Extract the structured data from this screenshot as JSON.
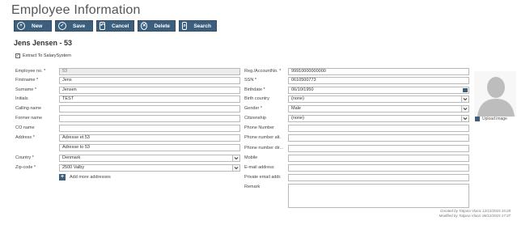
{
  "page": {
    "title": "Employee Information"
  },
  "toolbar": {
    "buttons": [
      {
        "label": "New",
        "icon": "plus-circle-icon"
      },
      {
        "label": "Save",
        "icon": "check-circle-icon"
      },
      {
        "label": "Cancel",
        "icon": "cancel-icon"
      },
      {
        "label": "Delete",
        "icon": "delete-x-icon"
      },
      {
        "label": "Search",
        "icon": "search-icon"
      }
    ]
  },
  "employee": {
    "heading": "Jens Jensen - 53"
  },
  "extract": {
    "label": "Extract To SalarySystem",
    "checked": true
  },
  "left": {
    "employee_no": {
      "label": "Employee no. *",
      "value": "53"
    },
    "firstname": {
      "label": "Firstname *",
      "value": "Jens"
    },
    "surname": {
      "label": "Surname *",
      "value": "Jensen"
    },
    "initials": {
      "label": "Initials",
      "value": "TEST"
    },
    "calling_name": {
      "label": "Calling name",
      "value": ""
    },
    "former_name": {
      "label": "Former name",
      "value": ""
    },
    "co_name": {
      "label": "CO name",
      "value": ""
    },
    "address": {
      "label": "Address *",
      "line1": "Adresse et 53",
      "line2": "Adresse to 53"
    },
    "country": {
      "label": "Country *",
      "value": "Denmark"
    },
    "zip": {
      "label": "Zip-code *",
      "value": "2500 Valby"
    },
    "add_more": "Add more addresses"
  },
  "right": {
    "reg_account": {
      "label": "Reg./AccountNo. *",
      "value": "99910000000000"
    },
    "ssn": {
      "label": "SSN *",
      "value": "0610500773"
    },
    "birthdate": {
      "label": "Birthdate *",
      "value": "06/10/1950"
    },
    "birth_country": {
      "label": "Birth country",
      "value": "(none)"
    },
    "gender": {
      "label": "Gender *",
      "value": "Male"
    },
    "citizenship": {
      "label": "Citizenship",
      "value": "(none)"
    },
    "phone": {
      "label": "Phone Number",
      "value": ""
    },
    "phone_alt": {
      "label": "Phone number alt.",
      "value": ""
    },
    "phone_dir": {
      "label": "Phone number dir...",
      "value": ""
    },
    "mobile": {
      "label": "Mobile",
      "value": ""
    },
    "email": {
      "label": "E-mail address",
      "value": ""
    },
    "private_email": {
      "label": "Private email addr.",
      "value": ""
    },
    "remark": {
      "label": "Remark",
      "value": ""
    }
  },
  "photo": {
    "upload_label": "Upload image"
  },
  "audit": {
    "created": "Created by Tatjana Vlacic 12/11/2015 15:28",
    "modified": "Modified by Tatjana Vlacic 06/12/2015 17:37"
  },
  "colors": {
    "accent": "#3b5f7d",
    "field_border": "#b9b9b9",
    "readonly_bg": "#ececec"
  }
}
